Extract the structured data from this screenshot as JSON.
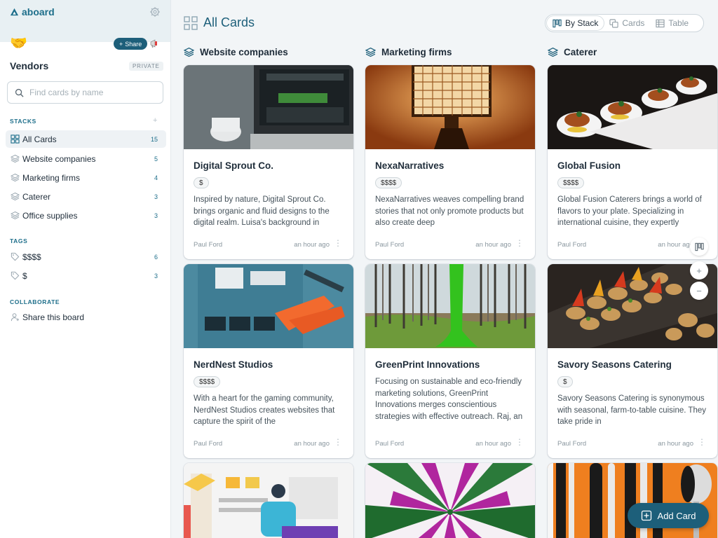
{
  "app": {
    "logo_text": "aboard"
  },
  "board": {
    "title": "Vendors",
    "visibility": "PRIVATE",
    "share_label": "Share",
    "emoji": "🤝"
  },
  "search": {
    "placeholder": "Find cards by name",
    "value": ""
  },
  "sidebar": {
    "stacks_label": "STACKS",
    "stacks_add": "+",
    "stacks": [
      {
        "label": "All Cards",
        "count": "15",
        "icon": "grid-icon",
        "active": true
      },
      {
        "label": "Website companies",
        "count": "5",
        "icon": "layers-icon"
      },
      {
        "label": "Marketing firms",
        "count": "4",
        "icon": "layers-icon"
      },
      {
        "label": "Caterer",
        "count": "3",
        "icon": "layers-icon"
      },
      {
        "label": "Office supplies",
        "count": "3",
        "icon": "layers-icon"
      }
    ],
    "tags_label": "TAGS",
    "tags": [
      {
        "label": "$$$$",
        "count": "6",
        "icon": "tag-icon"
      },
      {
        "label": "$",
        "count": "3",
        "icon": "tag-icon"
      }
    ],
    "collaborate_label": "COLLABORATE",
    "share_board_label": "Share this board"
  },
  "main": {
    "title": "All Cards",
    "views": [
      {
        "label": "By Stack",
        "active": true
      },
      {
        "label": "Cards",
        "active": false
      },
      {
        "label": "Table",
        "active": false
      }
    ],
    "add_card_label": "Add Card",
    "columns": [
      {
        "name": "Website companies",
        "cards": [
          {
            "title": "Digital Sprout Co.",
            "tag": "$",
            "description": "Inspired by nature, Digital Sprout Co. brings organic and fluid designs to the digital realm. Luisa's background in",
            "author": "Paul Ford",
            "time": "an hour ago"
          },
          {
            "title": "NerdNest Studios",
            "tag": "$$$$",
            "description": "With a heart for the gaming community, NerdNest Studios creates websites that capture the spirit of the",
            "author": "Paul Ford",
            "time": "an hour ago"
          }
        ]
      },
      {
        "name": "Marketing firms",
        "cards": [
          {
            "title": "NexaNarratives",
            "tag": "$$$$",
            "description": "NexaNarratives weaves compelling brand stories that not only promote products but also create deep",
            "author": "Paul Ford",
            "time": "an hour ago"
          },
          {
            "title": "GreenPrint Innovations",
            "tag": "",
            "description": "Focusing on sustainable and eco-friendly marketing solutions, GreenPrint Innovations merges conscientious strategies with effective outreach. Raj, an environmentalist at",
            "author": "Paul Ford",
            "time": "an hour ago"
          }
        ]
      },
      {
        "name": "Caterer",
        "cards": [
          {
            "title": "Global Fusion",
            "tag": "$$$$",
            "description": "Global Fusion Caterers brings a world of flavors to your plate. Specializing in international cuisine, they expertly",
            "author": "Paul Ford",
            "time": "an hour ago"
          },
          {
            "title": "Savory Seasons Catering",
            "tag": "$",
            "description": "Savory Seasons Catering is synonymous with seasonal, farm-to-table cuisine. They take pride in",
            "author": "Paul Ford",
            "time": "an hour ago"
          }
        ]
      }
    ]
  },
  "colors": {
    "brand": "#1d5f7a",
    "accent": "#1d6e8a"
  }
}
